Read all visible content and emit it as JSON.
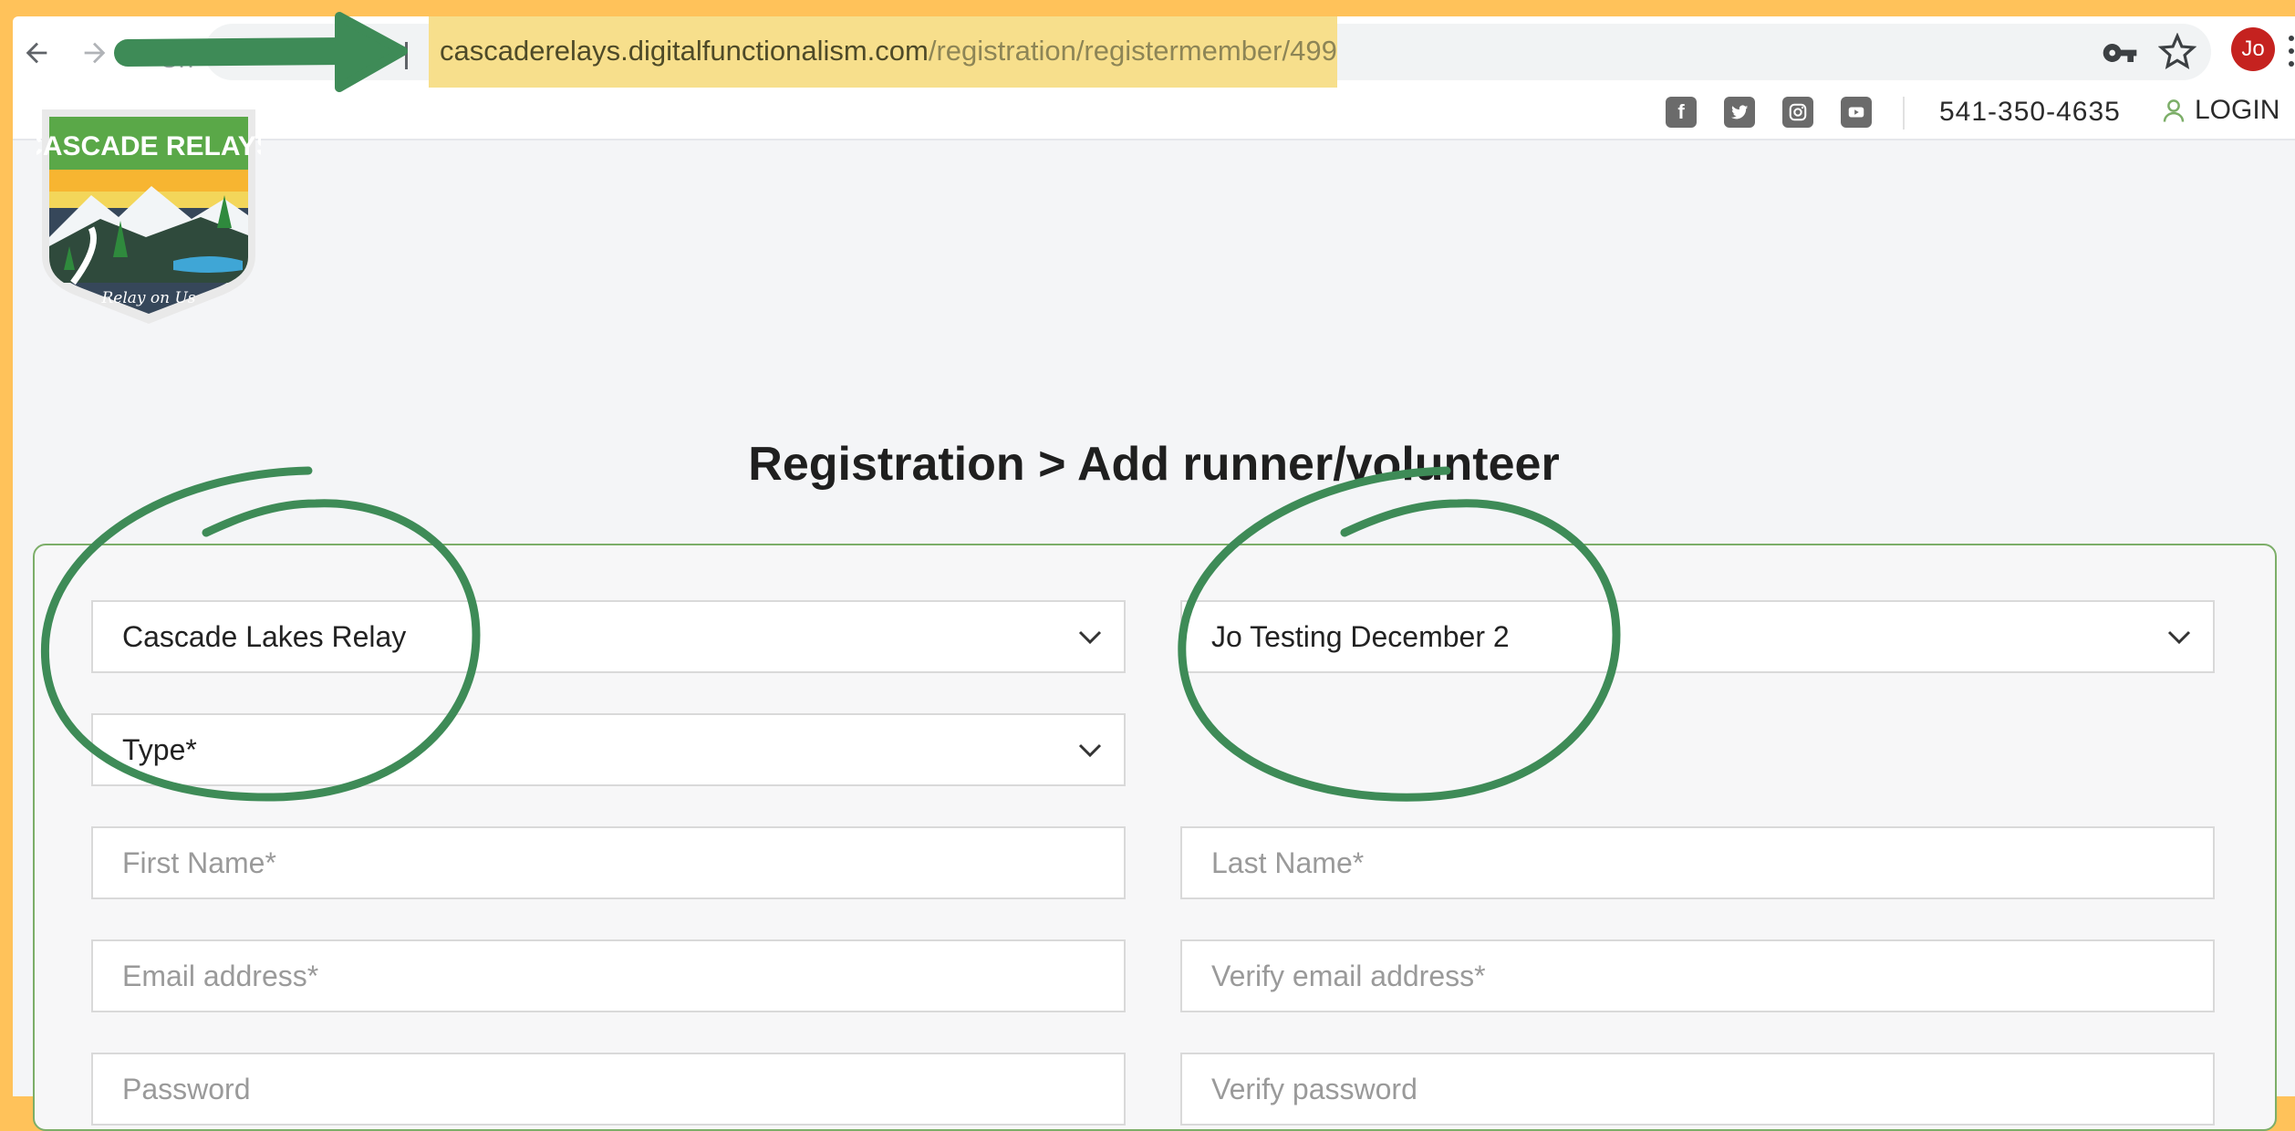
{
  "browser": {
    "tab_title_fragment": "Ch",
    "url_host": "cascaderelays.digitalfunctionalism.com",
    "url_path": "/registration/registermember/499",
    "avatar_initials": "Jo"
  },
  "site": {
    "logo_text_top": "CASCADE RELAYS",
    "logo_text_bottom": "Relay on Us",
    "phone": "541-350-4635",
    "login_label": "LOGIN",
    "social_icons": [
      "facebook-icon",
      "twitter-icon",
      "instagram-icon",
      "youtube-icon"
    ]
  },
  "page": {
    "title": "Registration > Add runner/volunteer"
  },
  "form": {
    "event_select": "Cascade Lakes Relay",
    "team_select": "Jo Testing December 2",
    "type_select": "Type*",
    "first_name_placeholder": "First Name*",
    "last_name_placeholder": "Last Name*",
    "email_placeholder": "Email address*",
    "verify_email_placeholder": "Verify email address*",
    "password_placeholder": "Password",
    "verify_password_placeholder": "Verify password"
  },
  "colors": {
    "frame": "#FFC25A",
    "highlight": "#F7DF8C",
    "annotation_green": "#3E8B57",
    "form_border": "#7cae68",
    "avatar": "#C5221F"
  }
}
